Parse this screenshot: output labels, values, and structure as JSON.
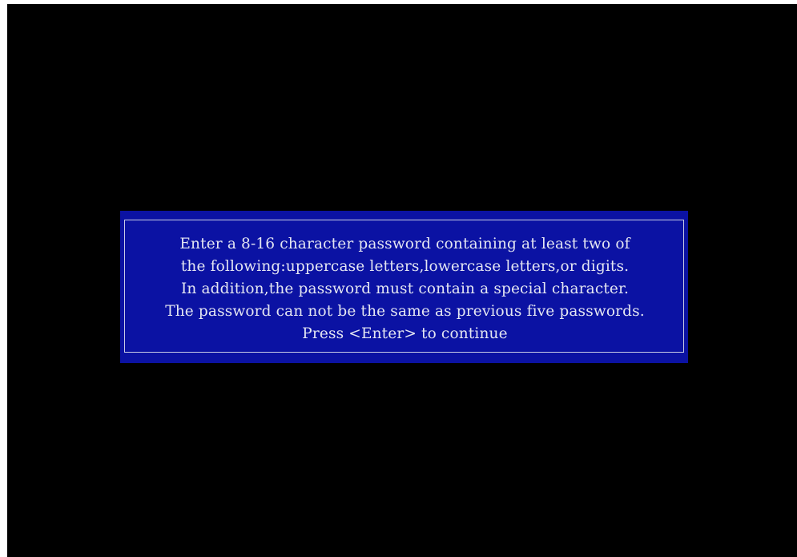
{
  "dialog": {
    "lines": [
      "Enter a 8-16 character password containing at least two of",
      "the following:uppercase letters,lowercase letters,or digits.",
      "In addition,the password must contain a special character.",
      "The password can not be the same as previous five passwords."
    ],
    "prompt": "Press <Enter> to continue"
  },
  "colors": {
    "background": "#000000",
    "dialog_background": "#0b12a3",
    "text": "#e4e6f2",
    "frame": "#c8cbe6"
  }
}
